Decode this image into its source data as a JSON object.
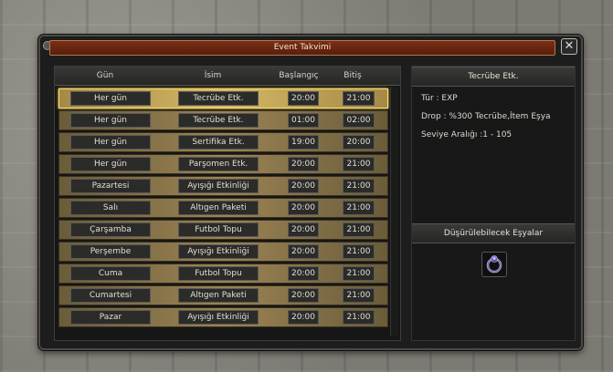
{
  "window": {
    "title": "Event Takvimi",
    "close_glyph": "✕"
  },
  "table": {
    "headers": {
      "day": "Gün",
      "name": "İsim",
      "start": "Başlangıç",
      "end": "Bitiş"
    },
    "rows": [
      {
        "day": "Her gün",
        "name": "Tecrübe Etk.",
        "start": "20:00",
        "end": "21:00"
      },
      {
        "day": "Her gün",
        "name": "Tecrübe Etk.",
        "start": "01:00",
        "end": "02:00"
      },
      {
        "day": "Her gün",
        "name": "Sertifika Etk.",
        "start": "19:00",
        "end": "20:00"
      },
      {
        "day": "Her gün",
        "name": "Parşomen Etk.",
        "start": "20:00",
        "end": "21:00"
      },
      {
        "day": "Pazartesi",
        "name": "Ayışığı Etkinliği",
        "start": "20:00",
        "end": "21:00"
      },
      {
        "day": "Salı",
        "name": "Altıgen Paketi",
        "start": "20:00",
        "end": "21:00"
      },
      {
        "day": "Çarşamba",
        "name": "Futbol Topu",
        "start": "20:00",
        "end": "21:00"
      },
      {
        "day": "Perşembe",
        "name": "Ayışığı Etkinliği",
        "start": "20:00",
        "end": "21:00"
      },
      {
        "day": "Cuma",
        "name": "Futbol Topu",
        "start": "20:00",
        "end": "21:00"
      },
      {
        "day": "Cumartesi",
        "name": "Altıgen Paketi",
        "start": "20:00",
        "end": "21:00"
      },
      {
        "day": "Pazar",
        "name": "Ayışığı Etkinliği",
        "start": "20:00",
        "end": "21:00"
      }
    ]
  },
  "detail": {
    "title": "Tecrübe Etk.",
    "type_line": "Tür : EXP",
    "drop_line": "Drop : %300 Tecrübe,İtem Eşya",
    "level_line": "Seviye Aralığı :1 - 105",
    "drops_header": "Düşürülebilecek Eşyalar",
    "drop_item_icon": "ring-icon"
  },
  "colors": {
    "accent": "#ffe27a",
    "title_bar": "#6a2612",
    "row_gold": "#9c8454"
  }
}
